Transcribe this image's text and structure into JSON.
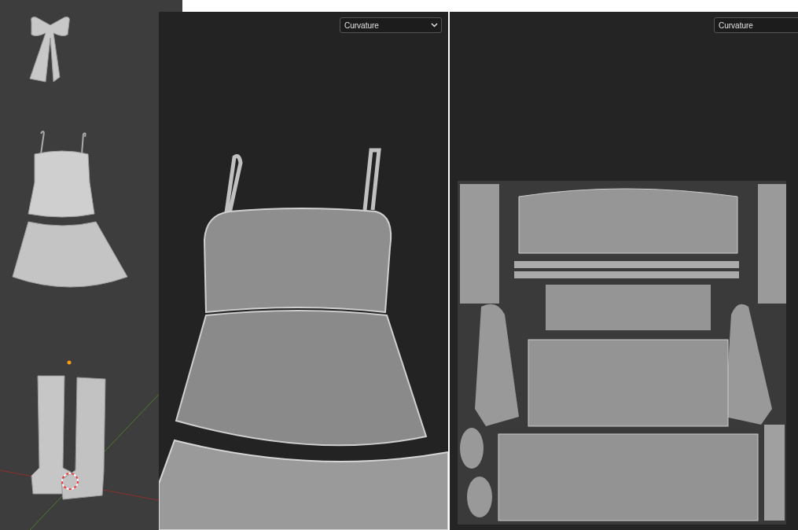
{
  "panels": [
    {
      "kind": "dropdown",
      "channel": "Curvature"
    },
    {
      "kind": "cut_dropdown",
      "channel": "Curvature"
    }
  ]
}
